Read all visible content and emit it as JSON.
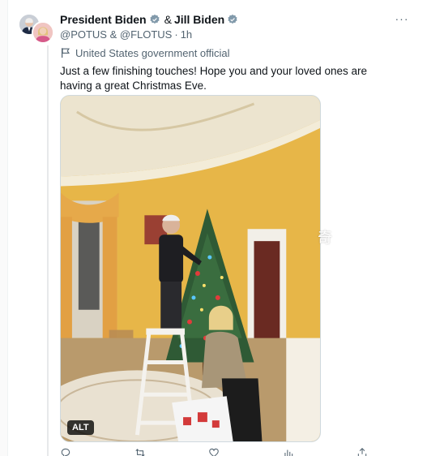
{
  "tweet": {
    "author_1": "President Biden",
    "author_2": "Jill Biden",
    "ampersand": "&",
    "handles": "@POTUS & @FLOTUS",
    "time": "1h",
    "label": "United States government official",
    "text": "Just a few finishing touches! Hope you and your loved ones are having a great Christmas Eve.",
    "more": "···"
  },
  "media": {
    "alt_badge": "ALT",
    "watermark": "奇"
  },
  "colors": {
    "text": "#0f1419",
    "secondary": "#536471",
    "verified": "#829aab",
    "wall": "#e8b84a"
  },
  "icons": [
    "verified-badge-icon",
    "government-flag-icon",
    "more-icon",
    "reply-icon",
    "retweet-icon",
    "like-icon",
    "views-icon",
    "share-icon"
  ]
}
